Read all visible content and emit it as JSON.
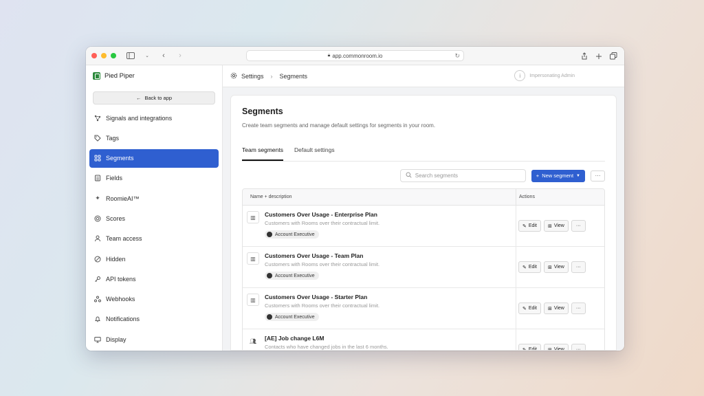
{
  "browser": {
    "url": "app.commonroom.io"
  },
  "sidebar": {
    "org_name": "Pied Piper",
    "back_label": "Back to app",
    "items": [
      {
        "label": "Signals and integrations",
        "icon": "signals-icon"
      },
      {
        "label": "Tags",
        "icon": "tag-icon"
      },
      {
        "label": "Segments",
        "icon": "segments-icon",
        "active": true
      },
      {
        "label": "Fields",
        "icon": "fields-icon"
      },
      {
        "label": "RoomieAI™",
        "icon": "sparkle-icon"
      },
      {
        "label": "Scores",
        "icon": "scores-icon"
      },
      {
        "label": "Team access",
        "icon": "user-icon"
      },
      {
        "label": "Hidden",
        "icon": "hidden-icon"
      },
      {
        "label": "API tokens",
        "icon": "key-icon"
      },
      {
        "label": "Webhooks",
        "icon": "webhook-icon"
      },
      {
        "label": "Notifications",
        "icon": "bell-icon"
      },
      {
        "label": "Display",
        "icon": "display-icon"
      }
    ]
  },
  "header": {
    "breadcrumb_root": "Settings",
    "breadcrumb_current": "Segments",
    "impersonating": "Impersonating Admin"
  },
  "page": {
    "title": "Segments",
    "subtitle": "Create team segments and manage default settings for segments in your room.",
    "tabs": [
      "Team segments",
      "Default settings"
    ],
    "search_placeholder": "Search segments",
    "new_segment_label": "New segment",
    "more_label": "···"
  },
  "table": {
    "col_name": "Name + description",
    "col_actions": "Actions",
    "edit_label": "Edit",
    "view_label": "View",
    "more_label": "···",
    "rows": [
      {
        "title": "Customers Over Usage - Enterprise Plan",
        "desc": "Customers with Rooms over their contractual limit.",
        "chip": "Account Executive"
      },
      {
        "title": "Customers Over Usage - Team Plan",
        "desc": "Customers with Rooms over their contractual limit.",
        "chip": "Account Executive"
      },
      {
        "title": "Customers Over Usage - Starter Plan",
        "desc": "Customers with Rooms over their contractual limit.",
        "chip": "Account Executive"
      },
      {
        "title": "[AE] Job change L6M",
        "desc": "Contacts who have changed jobs in the last 6 months.",
        "chip": ""
      }
    ]
  }
}
